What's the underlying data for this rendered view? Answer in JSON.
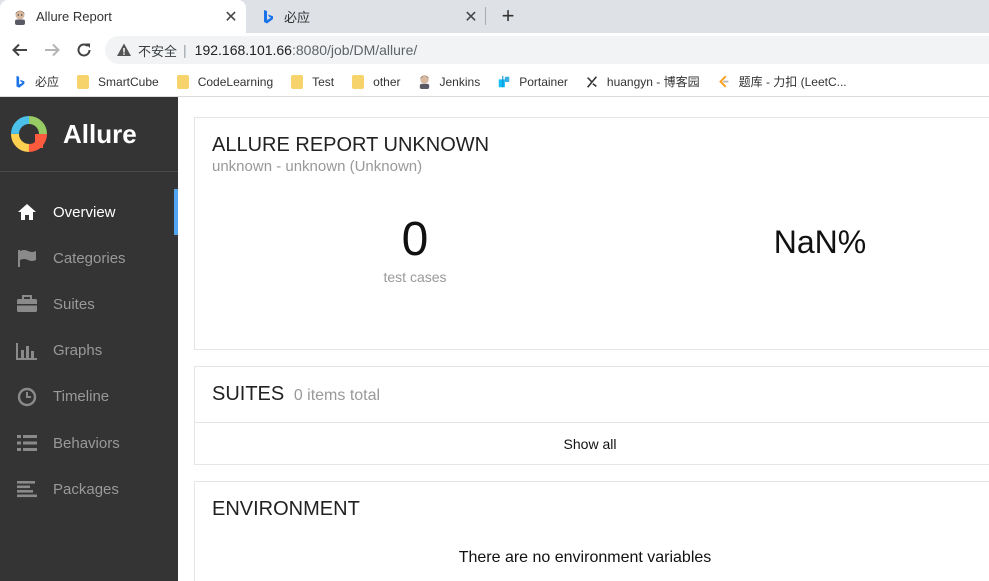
{
  "browser": {
    "tabs": [
      {
        "title": "Allure Report",
        "active": true,
        "icon": "jenkins-avatar-icon"
      },
      {
        "title": "必应",
        "active": false,
        "icon": "bing-icon"
      }
    ],
    "address": {
      "security_label": "不安全",
      "host": "192.168.101.66",
      "path": ":8080/job/DM/allure/"
    },
    "bookmarks": [
      {
        "label": "必应",
        "icon": "bing-icon"
      },
      {
        "label": "SmartCube",
        "icon": "folder-icon"
      },
      {
        "label": "CodeLearning",
        "icon": "folder-icon"
      },
      {
        "label": "Test",
        "icon": "folder-icon"
      },
      {
        "label": "other",
        "icon": "folder-icon"
      },
      {
        "label": "Jenkins",
        "icon": "jenkins-avatar-icon"
      },
      {
        "label": "Portainer",
        "icon": "portainer-icon"
      },
      {
        "label": "huangyn - 博客园",
        "icon": "cnblogs-icon"
      },
      {
        "label": "题库 - 力扣 (LeetC...",
        "icon": "leetcode-icon"
      }
    ]
  },
  "sidebar": {
    "brand": "Allure",
    "items": [
      {
        "label": "Overview",
        "icon": "home-icon",
        "active": true
      },
      {
        "label": "Categories",
        "icon": "flag-icon",
        "active": false
      },
      {
        "label": "Suites",
        "icon": "briefcase-icon",
        "active": false
      },
      {
        "label": "Graphs",
        "icon": "bar-chart-icon",
        "active": false
      },
      {
        "label": "Timeline",
        "icon": "clock-icon",
        "active": false
      },
      {
        "label": "Behaviors",
        "icon": "list-icon",
        "active": false
      },
      {
        "label": "Packages",
        "icon": "align-left-icon",
        "active": false
      }
    ]
  },
  "summary": {
    "title": "ALLURE REPORT UNKNOWN",
    "subtitle": "unknown - unknown (Unknown)",
    "test_count": "0",
    "test_count_label": "test cases",
    "success_rate": "NaN%"
  },
  "suites": {
    "title": "SUITES",
    "count_label": "0 items total",
    "show_all": "Show all"
  },
  "environment": {
    "title": "ENVIRONMENT",
    "empty_message": "There are no environment variables"
  },
  "colors": {
    "sidebar_bg": "#343434",
    "active_indicator": "#52a6f1",
    "muted_text": "#999999"
  }
}
